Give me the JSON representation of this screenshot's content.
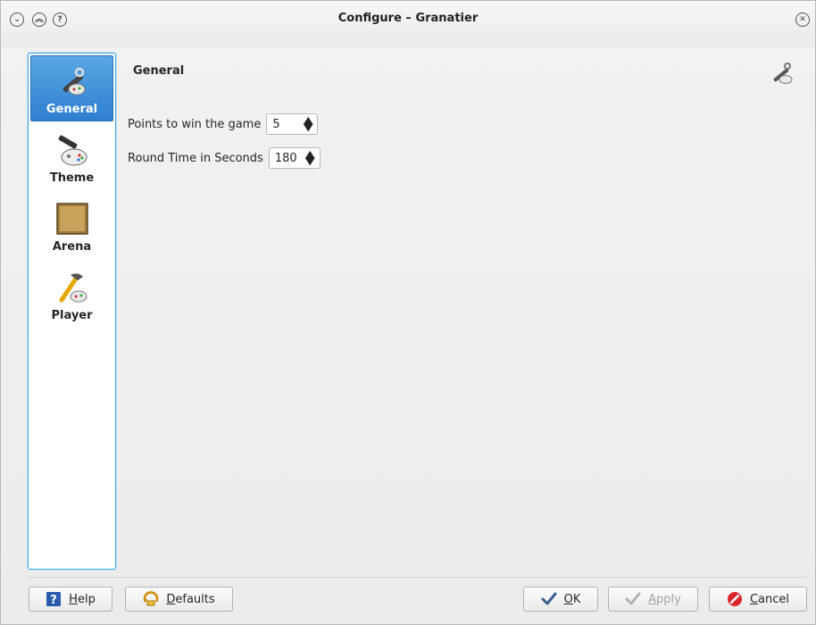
{
  "window": {
    "title": "Configure – Granatier",
    "controls": {
      "minimize": "chevron-down-icon",
      "maximize": "double-chevron-up-icon",
      "help": "question-icon",
      "close": "close-icon"
    }
  },
  "sidebar": {
    "items": [
      {
        "label": "General",
        "icon": "general-settings-icon",
        "selected": true
      },
      {
        "label": "Theme",
        "icon": "theme-icon",
        "selected": false
      },
      {
        "label": "Arena",
        "icon": "arena-icon",
        "selected": false
      },
      {
        "label": "Player",
        "icon": "player-icon",
        "selected": false
      }
    ]
  },
  "page": {
    "title": "General",
    "fields": [
      {
        "label": "Points to win the game",
        "value": "5"
      },
      {
        "label": "Round Time in Seconds",
        "value": "180"
      }
    ]
  },
  "buttons": {
    "help": {
      "mnemonic": "H",
      "rest": "elp"
    },
    "defaults": {
      "mnemonic": "D",
      "rest": "efaults"
    },
    "ok": {
      "mnemonic": "O",
      "rest": "K"
    },
    "apply": {
      "mnemonic": "A",
      "rest": "pply"
    },
    "cancel": {
      "mnemonic": "C",
      "rest": "ancel"
    }
  },
  "colors": {
    "accent": "#3daee9",
    "selected": "#3584d6"
  }
}
